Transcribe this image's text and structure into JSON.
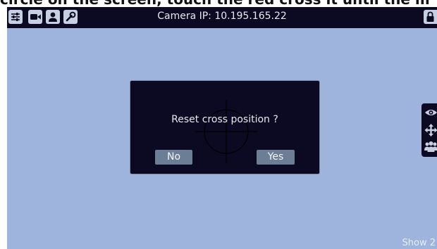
{
  "caption": "circle on the screen, touch the red cross it until the m",
  "topbar": {
    "camera_ip": "Camera IP: 10.195.165.22",
    "icons": [
      "sliders-icon",
      "video-camera-icon",
      "user-icon",
      "wrench-icon",
      "lock-icon"
    ]
  },
  "side_panel": {
    "icons": [
      "eye-icon",
      "move-arrows-icon",
      "group-icon"
    ]
  },
  "dialog": {
    "message": "Reset cross position ?",
    "no_label": "No",
    "yes_label": "Yes"
  },
  "footer": {
    "show_label": "Show 2"
  },
  "colors": {
    "background": "#9fb4dc",
    "bar": "#0c0a22",
    "button": "#6b7e95"
  }
}
